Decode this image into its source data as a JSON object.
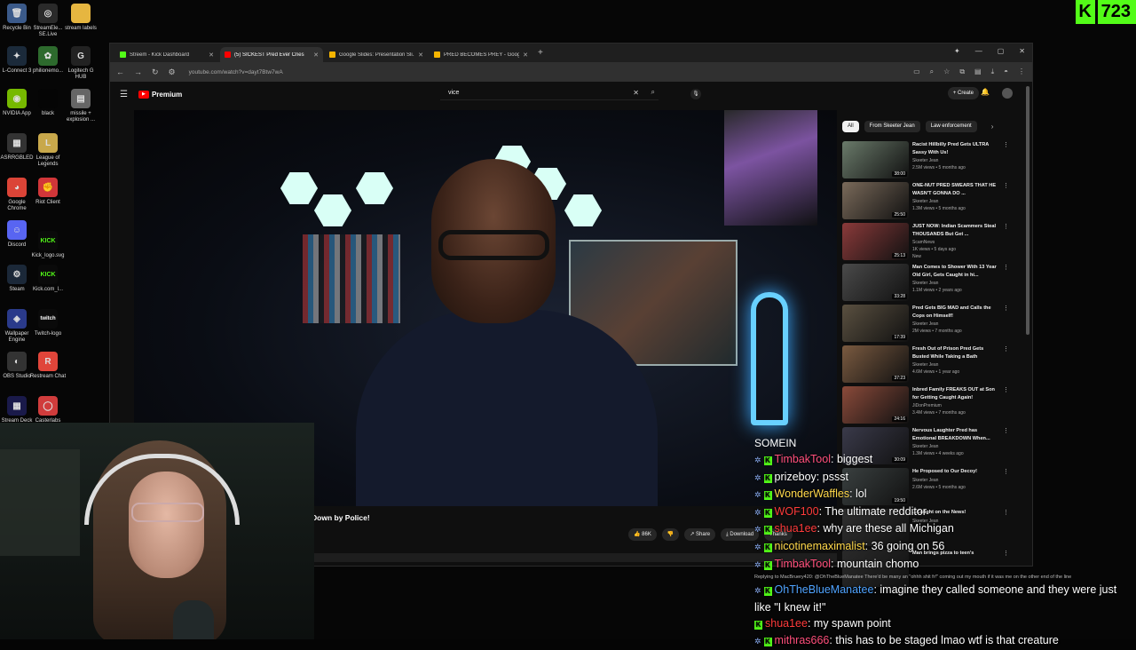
{
  "desktop": {
    "icons": [
      {
        "label": "Recycle Bin",
        "glyph": "🗑",
        "color": "#3b5a8a"
      },
      {
        "label": "StreamEle... SE.Live",
        "glyph": "◎",
        "color": "#2a2a2a"
      },
      {
        "label": "stream labels",
        "glyph": "",
        "color": "#e6b640"
      },
      {
        "label": "L-Connect 3",
        "glyph": "✦",
        "color": "#1b2a3a"
      },
      {
        "label": "philionemo...",
        "glyph": "✿",
        "color": "#2d6a2d"
      },
      {
        "label": "Logitech G HUB",
        "glyph": "G",
        "color": "#222"
      },
      {
        "label": "NVIDIA App",
        "glyph": "◉",
        "color": "#76b900"
      },
      {
        "label": "black",
        "glyph": "",
        "color": "#050505"
      },
      {
        "label": "missile + explosion ...",
        "glyph": "▤",
        "color": "#666"
      },
      {
        "label": "ASRRGBLED",
        "glyph": "▦",
        "color": "#333"
      },
      {
        "label": "League of Legends",
        "glyph": "L",
        "color": "#c8a84b"
      },
      {
        "label": "Google Chrome",
        "glyph": "◕",
        "color": "#db4437"
      },
      {
        "label": "Riot Client",
        "glyph": "✊",
        "color": "#d13639"
      },
      {
        "label": "Discord",
        "glyph": "☺",
        "color": "#5865f2"
      },
      {
        "label": "Kick_logo.svg",
        "glyph": "KICK",
        "color": "#0a0a0a"
      },
      {
        "label": "Steam",
        "glyph": "⚙",
        "color": "#1b2838"
      },
      {
        "label": "Kick.com_l...",
        "glyph": "KICK",
        "color": "#0a0a0a"
      },
      {
        "label": "Wallpaper Engine",
        "glyph": "◈",
        "color": "#2a3a8a"
      },
      {
        "label": "Twitch-logo",
        "glyph": "twitch",
        "color": "#0a0a0a"
      },
      {
        "label": "OBS Studio",
        "glyph": "◐",
        "color": "#333"
      },
      {
        "label": "Restream Chat",
        "glyph": "R",
        "color": "#e0453a"
      },
      {
        "label": "Stream Deck",
        "glyph": "▦",
        "color": "#1a1a4a"
      },
      {
        "label": "Casterlabs",
        "glyph": "◯",
        "color": "#d03c3c"
      }
    ]
  },
  "kick_counter": {
    "icon": "K",
    "count": "723",
    "color": "#53fc18"
  },
  "browser": {
    "tabs": [
      {
        "label": "Streem - Kick Dashboard",
        "fav_color": "#53fc18",
        "active": false
      },
      {
        "label": "(5) SICKEST Pred Ever Cries",
        "fav_color": "#ff0000",
        "active": true
      },
      {
        "label": "Google Slides: Presentation Sli...",
        "fav_color": "#f4b400",
        "active": false
      },
      {
        "label": "PRED BECOMES PREY - Google...",
        "fav_color": "#f4b400",
        "active": false
      }
    ],
    "new_tab": "+",
    "url": "youtube.com/watch?v=dayt7Btw7wA"
  },
  "youtube": {
    "brand": "Premium",
    "search_value": "vice",
    "create_label": "Create",
    "notif_count": "9",
    "video_title": "Down by Police!",
    "actions": {
      "likes": "86K",
      "share": "Share",
      "download": "Download",
      "thanks": "Thanks"
    },
    "chips": [
      "All",
      "From Skeeter Jean",
      "Law enforcement"
    ],
    "sidebar": [
      {
        "title": "Racist Hillbilly Pred Gets ULTRA Sassy With Us!",
        "channel": "Skeeter Jean",
        "meta": "2.5M views • 5 months ago",
        "dur": "38:00",
        "color": "#6a7a6a"
      },
      {
        "title": "ONE-NUT PRED SWEARS THAT HE WASN'T GONNA DO ...",
        "channel": "Skeeter Jean",
        "meta": "1.3M views • 5 months ago",
        "dur": "25:50",
        "color": "#7a6a5a"
      },
      {
        "title": "JUST NOW: Indian Scammers Steal THOUSANDS But Get ...",
        "channel": "ScamNews",
        "meta": "1K views • 5 days ago",
        "dur": "25:13",
        "color": "#8a3a3a",
        "new": "New"
      },
      {
        "title": "Man Comes to Shower With 13 Year Old Girl, Gets Caught in hi...",
        "channel": "Skeeter Jean",
        "meta": "1.1M views • 2 years ago",
        "dur": "33:28",
        "color": "#4a4a4a"
      },
      {
        "title": "Pred Gets BIG MAD and Calls the Cops on Himself!",
        "channel": "Skeeter Jean",
        "meta": "2M views • 7 months ago",
        "dur": "17:39",
        "color": "#5a5040"
      },
      {
        "title": "Fresh Out of Prison Pred Gets Busted While Taking a Bath",
        "channel": "Skeeter Jean",
        "meta": "4.6M views • 1 year ago",
        "dur": "37:23",
        "color": "#7a5a40"
      },
      {
        "title": "Inbred Family FREAKS OUT at Son for Getting Caught Again!",
        "channel": "JiDonPremium",
        "meta": "3.4M views • 7 months ago",
        "dur": "24:16",
        "color": "#8a4a3a"
      },
      {
        "title": "Nervous Laughter Pred has Emotional BREAKDOWN When...",
        "channel": "Skeeter Jean",
        "meta": "1.3M views • 4 weeks ago",
        "dur": "30:09",
        "color": "#3a3a4a"
      },
      {
        "title": "He Proposed to Our Decoy!",
        "channel": "Skeeter Jean",
        "meta": "2.6M views • 5 months ago",
        "dur": "19:50",
        "color": "#3a4040"
      },
      {
        "title": "...Caught on the News!",
        "channel": "Skeeter Jean",
        "meta": "",
        "dur": "",
        "color": "#303030"
      },
      {
        "title": "Man brings pizza to teen's",
        "channel": "",
        "meta": "",
        "dur": "",
        "color": "#2a2a2a"
      }
    ]
  },
  "chat": {
    "header": "SOMEIN",
    "messages": [
      {
        "user": "TimbakTool",
        "color": "#ff4f7b",
        "text": "biggest"
      },
      {
        "user": "prizeboy",
        "color": "#ffffff",
        "text": "pssst"
      },
      {
        "user": "WonderWaffles",
        "color": "#ffd84a",
        "text": "lol"
      },
      {
        "user": "WOF100",
        "color": "#ff3b3b",
        "text": "The ultimate redditor"
      },
      {
        "user": "shua1ee",
        "color": "#ff3b3b",
        "text": "why are these all Michigan"
      },
      {
        "user": "nicotinemaximalist",
        "color": "#ffd84a",
        "text": "36 going on 56"
      },
      {
        "user": "TimbakTool",
        "color": "#ff4f7b",
        "text": "mountain chomo"
      },
      {
        "user": "OhTheBlueManatee",
        "color": "#4fa3ff",
        "text": "imagine they called someone and they were just like \"I knew it!\""
      },
      {
        "user": "shua1ee",
        "color": "#ff3b3b",
        "text": "my spawn point"
      },
      {
        "user": "mithras666",
        "color": "#ff4f7b",
        "text": "this has to be staged lmao wtf is that creature"
      }
    ],
    "reply_line": "Replying to MacBruery420: @OhTheBlueManatee There'd be many an \"ohhh shit fr!\" coming out my mouth if it was me on the other end of the line"
  }
}
